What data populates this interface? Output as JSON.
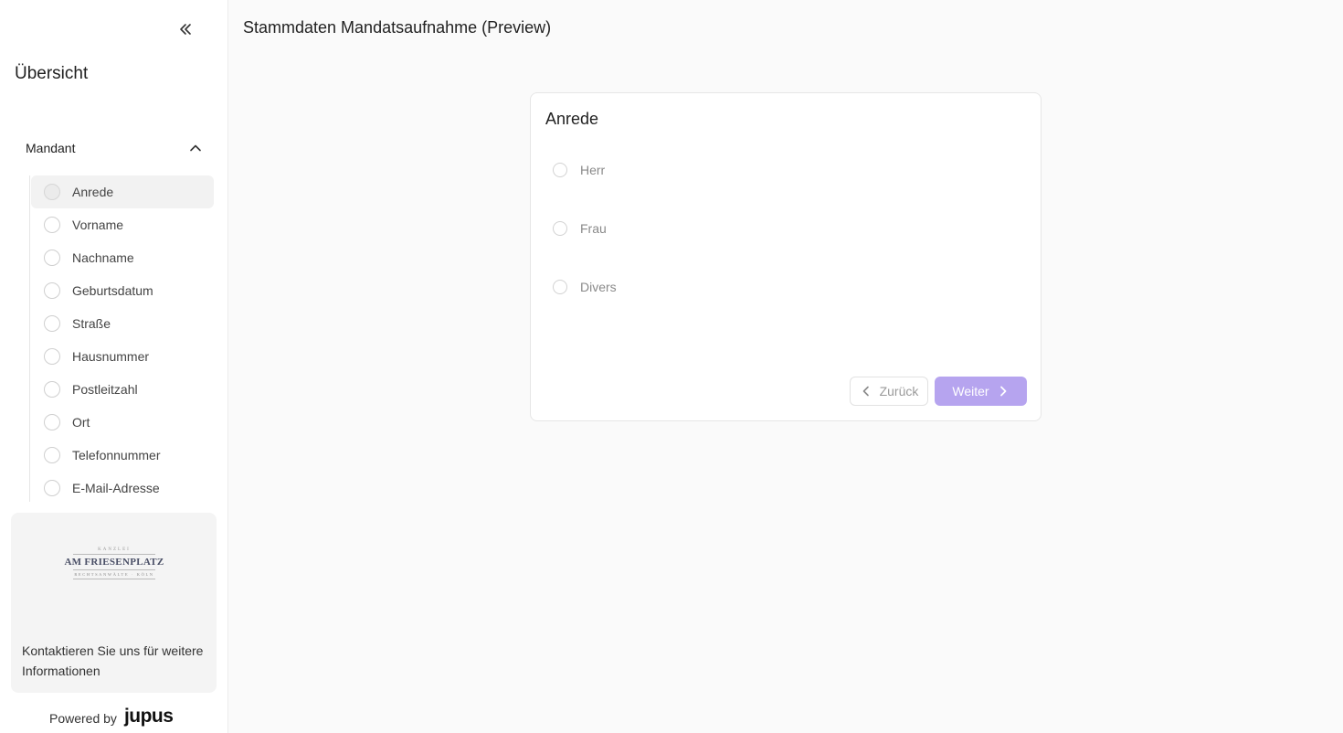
{
  "header": {
    "title": "Stammdaten Mandatsaufnahme (Preview)"
  },
  "sidebar": {
    "title": "Übersicht",
    "group": {
      "label": "Mandant",
      "expanded": true
    },
    "items": [
      {
        "label": "Anrede",
        "active": true
      },
      {
        "label": "Vorname"
      },
      {
        "label": "Nachname"
      },
      {
        "label": "Geburtsdatum"
      },
      {
        "label": "Straße"
      },
      {
        "label": "Hausnummer"
      },
      {
        "label": "Postleitzahl"
      },
      {
        "label": "Ort"
      },
      {
        "label": "Telefonnummer"
      },
      {
        "label": "E-Mail-Adresse"
      }
    ],
    "contact": {
      "logo": {
        "top": "KANZLEI",
        "name": "AM FRIESENPLATZ",
        "sub": "RECHTSANWÄLTE · KÖLN"
      },
      "text": "Kontaktieren Sie uns für weitere Informationen"
    },
    "powered": {
      "prefix": "Powered by",
      "brand": "jupus"
    }
  },
  "form": {
    "question": "Anrede",
    "options": [
      "Herr",
      "Frau",
      "Divers"
    ],
    "back_label": "Zurück",
    "next_label": "Weiter"
  },
  "colors": {
    "primary_disabled": "#b6a4ef",
    "background": "#fafafa"
  }
}
